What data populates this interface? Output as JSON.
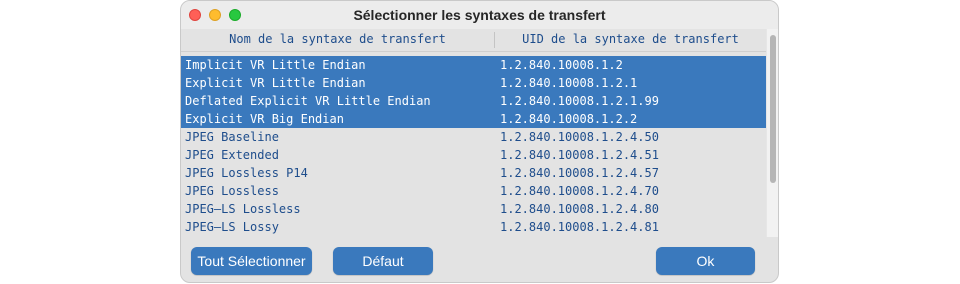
{
  "window": {
    "title": "Sélectionner les syntaxes de transfert"
  },
  "table": {
    "columns": [
      "Nom de la syntaxe de transfert",
      "UID de la syntaxe de transfert"
    ],
    "rows": [
      {
        "name": "Implicit VR Little Endian",
        "uid": "1.2.840.10008.1.2",
        "selected": true
      },
      {
        "name": "Explicit VR Little Endian",
        "uid": "1.2.840.10008.1.2.1",
        "selected": true
      },
      {
        "name": "Deflated Explicit VR Little Endian",
        "uid": "1.2.840.10008.1.2.1.99",
        "selected": true
      },
      {
        "name": "Explicit VR Big Endian",
        "uid": "1.2.840.10008.1.2.2",
        "selected": true
      },
      {
        "name": "JPEG Baseline",
        "uid": "1.2.840.10008.1.2.4.50",
        "selected": false
      },
      {
        "name": "JPEG Extended",
        "uid": "1.2.840.10008.1.2.4.51",
        "selected": false
      },
      {
        "name": "JPEG Lossless P14",
        "uid": "1.2.840.10008.1.2.4.57",
        "selected": false
      },
      {
        "name": "JPEG Lossless",
        "uid": "1.2.840.10008.1.2.4.70",
        "selected": false
      },
      {
        "name": "JPEG–LS Lossless",
        "uid": "1.2.840.10008.1.2.4.80",
        "selected": false
      },
      {
        "name": "JPEG–LS Lossy",
        "uid": "1.2.840.10008.1.2.4.81",
        "selected": false
      }
    ]
  },
  "buttons": {
    "select_all": "Tout Sélectionner",
    "default": "Défaut",
    "ok": "Ok"
  },
  "colors": {
    "selection": "#3a79bd",
    "text": "#1e4d8c",
    "button": "#3a79bd"
  }
}
